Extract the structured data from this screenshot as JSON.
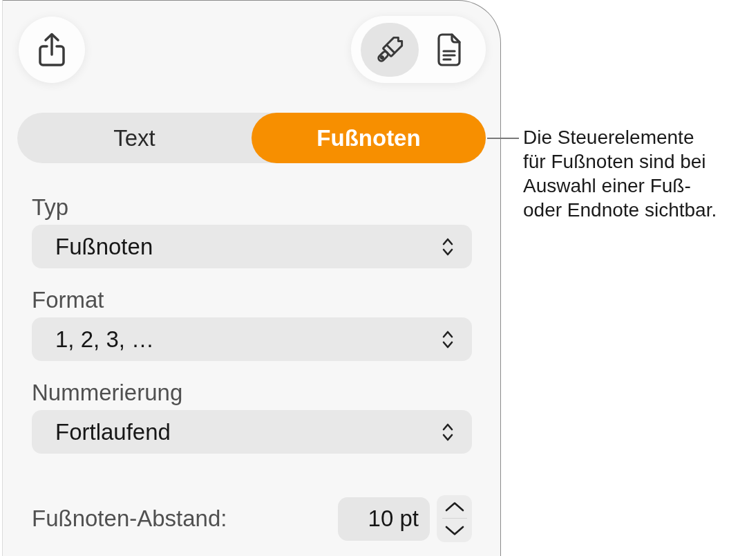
{
  "inspector_buttons": [
    {
      "kind": "format",
      "selected": true
    },
    {
      "kind": "document",
      "selected": false
    }
  ],
  "tabs": [
    {
      "label": "Text",
      "selected": false
    },
    {
      "label": "Fußnoten",
      "selected": true
    }
  ],
  "fields": [
    {
      "label": "Typ",
      "value": "Fußnoten"
    },
    {
      "label": "Format",
      "value": "1, 2, 3, …"
    },
    {
      "label": "Nummerierung",
      "value": "Fortlaufend"
    }
  ],
  "spacing": {
    "label": "Fußnoten-Abstand:",
    "value": "10 pt"
  },
  "callout": {
    "lines": [
      "Die Steuerelemente",
      "für Fußnoten sind bei",
      "Auswahl einer Fuß-",
      "oder Endnote sichtbar."
    ]
  }
}
